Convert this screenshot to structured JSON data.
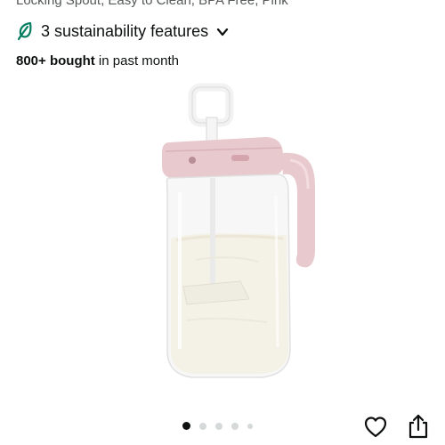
{
  "product": {
    "title_fragment": "Locking Spout, Easy to Clean, BPA Free, Pink",
    "sustainability": {
      "label": "3 sustainability features",
      "icon": "leaf-icon",
      "chevron": "chevron-down-icon",
      "accent_color": "#067d62"
    },
    "purchases": {
      "bought_strong": "800+ bought",
      "bought_rest": " in past month"
    },
    "image": {
      "description_icon": "pitcher-image",
      "lid_color": "#e8c9cd",
      "contents_color": "#f4f1e6"
    }
  },
  "carousel": {
    "total_dots": 5,
    "active_index": 0
  },
  "actions": {
    "favorite_icon": "heart-icon",
    "share_icon": "share-icon"
  }
}
